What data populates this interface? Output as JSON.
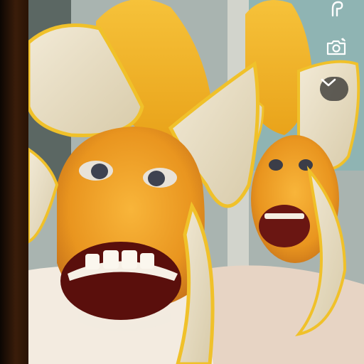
{
  "app": {
    "screen": "camera-filter-view",
    "filter_name": "banana-face",
    "colors": {
      "banana_yellow": "#f2b31a",
      "peel_cream": "#ece1c4",
      "skin_orange": "#f4a52b",
      "mouth_dark": "#5a0f0c",
      "control_bg": "#2a2a2a",
      "control_icon": "#ffffff"
    }
  },
  "controls": {
    "effects_icon": "effects-icon",
    "flip_icon": "camera-flip-icon",
    "more_icon": "chevron-down-icon"
  }
}
